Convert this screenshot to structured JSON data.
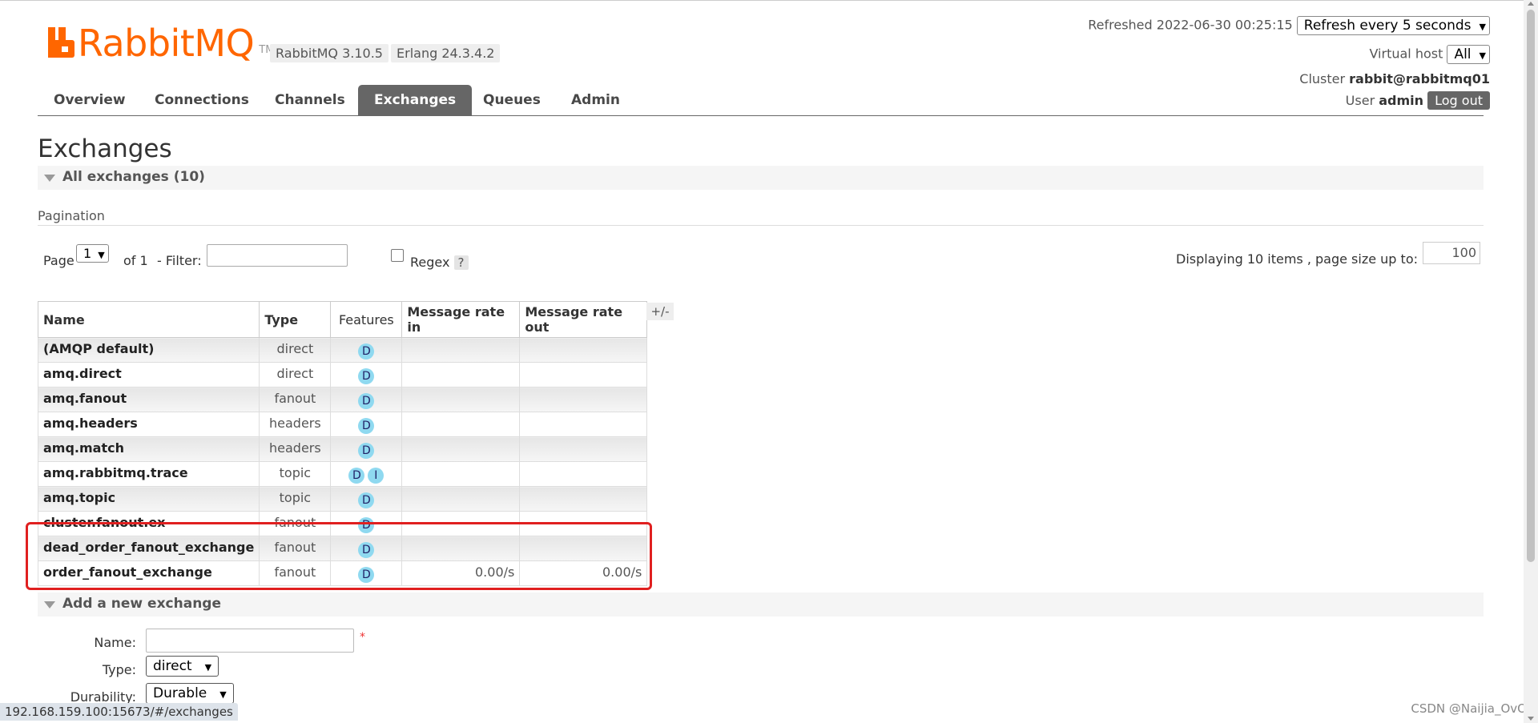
{
  "header": {
    "logo_text": "RabbitMQ",
    "logo_tm": "TM",
    "version_badge": "RabbitMQ 3.10.5",
    "erlang_badge": "Erlang 24.3.4.2",
    "refreshed_label": "Refreshed 2022-06-30 00:25:15",
    "refresh_select": "Refresh every 5 seconds",
    "vhost_label": "Virtual host",
    "vhost_select": "All",
    "cluster_label": "Cluster",
    "cluster_name": "rabbit@rabbitmq01",
    "user_label": "User",
    "user_name": "admin",
    "logout_label": "Log out"
  },
  "nav": {
    "tabs": [
      "Overview",
      "Connections",
      "Channels",
      "Exchanges",
      "Queues",
      "Admin"
    ],
    "active": "Exchanges"
  },
  "page_title": "Exchanges",
  "all_exchanges_label": "All exchanges (10)",
  "pagination": {
    "section_label": "Pagination",
    "page_label": "Page",
    "page_value": "1",
    "of_label": "of 1",
    "filter_label": "- Filter:",
    "regex_label": "Regex",
    "help_label": "?",
    "displaying_label": "Displaying 10 items , page size up to:",
    "page_size": "100"
  },
  "table": {
    "headers": [
      "Name",
      "Type",
      "Features",
      "Message rate in",
      "Message rate out"
    ],
    "plus_minus": "+/-",
    "rows": [
      {
        "name": "(AMQP default)",
        "type": "direct",
        "features": [
          "D"
        ],
        "rate_in": "",
        "rate_out": ""
      },
      {
        "name": "amq.direct",
        "type": "direct",
        "features": [
          "D"
        ],
        "rate_in": "",
        "rate_out": ""
      },
      {
        "name": "amq.fanout",
        "type": "fanout",
        "features": [
          "D"
        ],
        "rate_in": "",
        "rate_out": ""
      },
      {
        "name": "amq.headers",
        "type": "headers",
        "features": [
          "D"
        ],
        "rate_in": "",
        "rate_out": ""
      },
      {
        "name": "amq.match",
        "type": "headers",
        "features": [
          "D"
        ],
        "rate_in": "",
        "rate_out": ""
      },
      {
        "name": "amq.rabbitmq.trace",
        "type": "topic",
        "features": [
          "D",
          "I"
        ],
        "rate_in": "",
        "rate_out": ""
      },
      {
        "name": "amq.topic",
        "type": "topic",
        "features": [
          "D"
        ],
        "rate_in": "",
        "rate_out": ""
      },
      {
        "name": "cluster.fanout.ex",
        "type": "fanout",
        "features": [
          "D"
        ],
        "rate_in": "",
        "rate_out": ""
      },
      {
        "name": "dead_order_fanout_exchange",
        "type": "fanout",
        "features": [
          "D"
        ],
        "rate_in": "",
        "rate_out": ""
      },
      {
        "name": "order_fanout_exchange",
        "type": "fanout",
        "features": [
          "D"
        ],
        "rate_in": "0.00/s",
        "rate_out": "0.00/s"
      }
    ]
  },
  "add_exchange": {
    "section_label": "Add a new exchange",
    "name_label": "Name:",
    "required_mark": "*",
    "type_label": "Type:",
    "type_value": "direct",
    "durability_label": "Durability:",
    "durability_value": "Durable"
  },
  "status_url": "192.168.159.100:15673/#/exchanges",
  "watermark": "CSDN @Naijia_OvO"
}
